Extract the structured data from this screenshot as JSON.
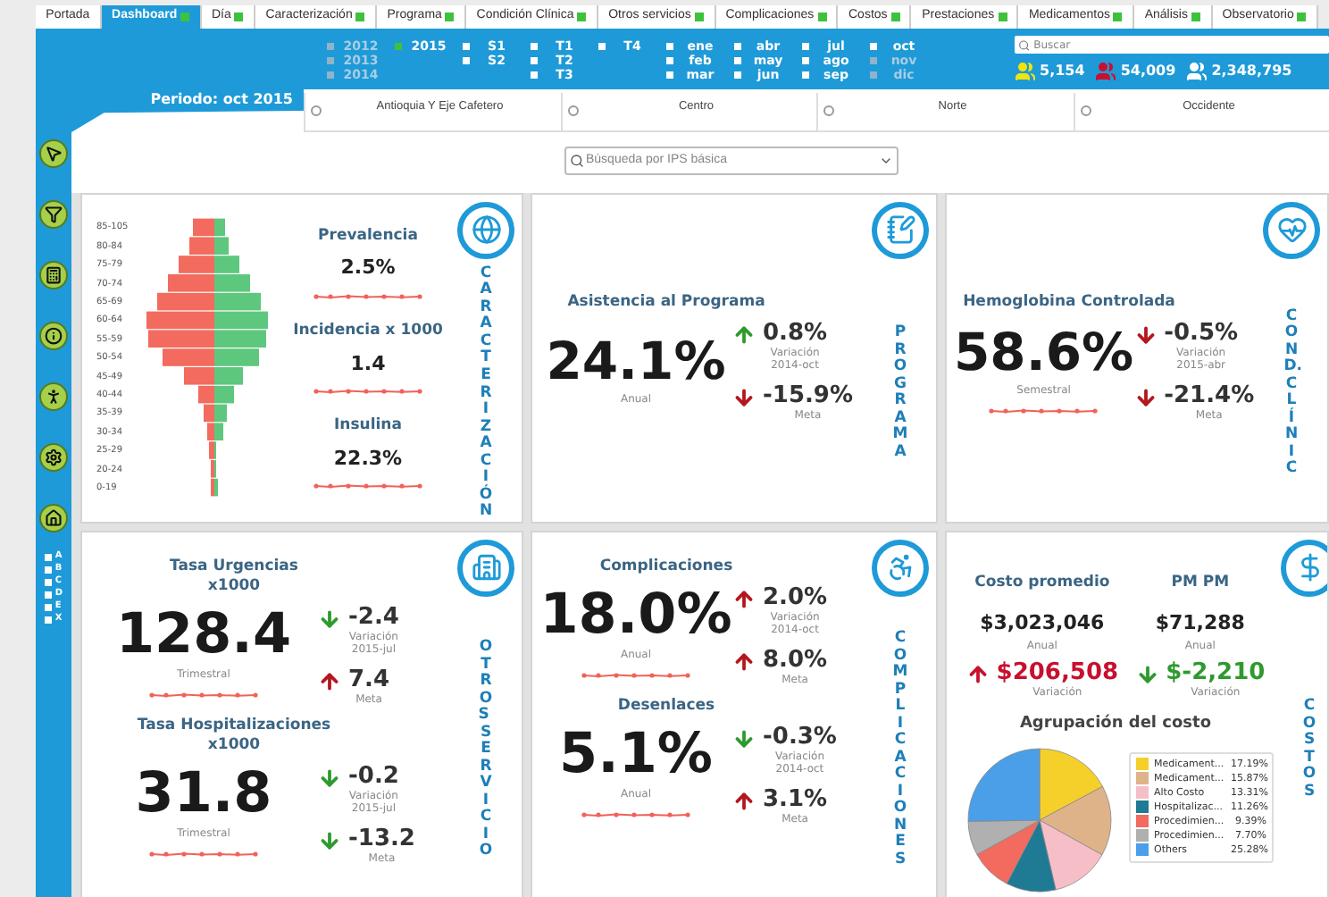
{
  "tabs": [
    {
      "label": "Portada",
      "selected": false,
      "status_dot": false
    },
    {
      "label": "Dashboard",
      "selected": true,
      "status_dot": true
    },
    {
      "label": "Día",
      "selected": false,
      "status_dot": true
    },
    {
      "label": "Caracterización",
      "selected": false,
      "status_dot": true
    },
    {
      "label": "Programa",
      "selected": false,
      "status_dot": true
    },
    {
      "label": "Condición Clínica",
      "selected": false,
      "status_dot": true
    },
    {
      "label": "Otros servicios",
      "selected": false,
      "status_dot": true
    },
    {
      "label": "Complicaciones",
      "selected": false,
      "status_dot": true
    },
    {
      "label": "Costos",
      "selected": false,
      "status_dot": true
    },
    {
      "label": "Prestaciones",
      "selected": false,
      "status_dot": true
    },
    {
      "label": "Medicamentos",
      "selected": false,
      "status_dot": true
    },
    {
      "label": "Análisis",
      "selected": false,
      "status_dot": true
    },
    {
      "label": "Observatorio",
      "selected": false,
      "status_dot": true
    }
  ],
  "period_selector": [
    {
      "items": [
        {
          "label": "2012",
          "selected": false,
          "disabled": true
        },
        {
          "label": "2013",
          "selected": false,
          "disabled": true
        },
        {
          "label": "2014",
          "selected": false,
          "disabled": true
        }
      ]
    },
    {
      "items": [
        {
          "label": "2015",
          "selected": true,
          "disabled": false
        }
      ]
    },
    {
      "items": [
        {
          "label": "S1",
          "selected": false,
          "disabled": false
        },
        {
          "label": "S2",
          "selected": false,
          "disabled": false
        }
      ]
    },
    {
      "items": [
        {
          "label": "T1",
          "selected": false,
          "disabled": false
        },
        {
          "label": "T2",
          "selected": false,
          "disabled": false
        },
        {
          "label": "T3",
          "selected": false,
          "disabled": false
        }
      ]
    },
    {
      "items": [
        {
          "label": "T4",
          "selected": false,
          "disabled": false
        }
      ]
    },
    {
      "items": [
        {
          "label": "ene",
          "selected": false,
          "disabled": false
        },
        {
          "label": "feb",
          "selected": false,
          "disabled": false
        },
        {
          "label": "mar",
          "selected": false,
          "disabled": false
        }
      ]
    },
    {
      "items": [
        {
          "label": "abr",
          "selected": false,
          "disabled": false
        },
        {
          "label": "may",
          "selected": false,
          "disabled": false
        },
        {
          "label": "jun",
          "selected": false,
          "disabled": false
        }
      ]
    },
    {
      "items": [
        {
          "label": "jul",
          "selected": false,
          "disabled": false
        },
        {
          "label": "ago",
          "selected": false,
          "disabled": false
        },
        {
          "label": "sep",
          "selected": false,
          "disabled": false
        }
      ]
    },
    {
      "items": [
        {
          "label": "oct",
          "selected": false,
          "disabled": false
        },
        {
          "label": "nov",
          "selected": false,
          "disabled": true
        },
        {
          "label": "dic",
          "selected": false,
          "disabled": true
        }
      ]
    }
  ],
  "search": {
    "placeholder": "Buscar"
  },
  "stats": [
    {
      "value": "5,154",
      "color": "#f2e40c"
    },
    {
      "value": "54,009",
      "color": "#c8102e"
    },
    {
      "value": "2,348,795",
      "color": "#ffffff"
    }
  ],
  "period_label": "Periodo: oct 2015",
  "regions": [
    {
      "label": "Antioquia Y Eje Cafetero",
      "selected": false
    },
    {
      "label": "Centro",
      "selected": false
    },
    {
      "label": "Norte",
      "selected": false
    },
    {
      "label": "Occidente",
      "selected": false
    }
  ],
  "ips_search": {
    "placeholder": "Búsqueda por IPS básica"
  },
  "sidebar": {
    "filters": [
      {
        "label": "A",
        "checked": false
      },
      {
        "label": "B",
        "checked": false
      },
      {
        "label": "C",
        "checked": false
      },
      {
        "label": "D",
        "checked": false
      },
      {
        "label": "E",
        "checked": false
      },
      {
        "label": "X",
        "checked": false
      }
    ]
  },
  "cards": [
    {
      "kind": "pyramid",
      "section": "CARACTERIZACIÓN",
      "age_groups": [
        "85-105",
        "80-84",
        "75-79",
        "70-74",
        "65-69",
        "60-64",
        "55-59",
        "50-54",
        "45-49",
        "40-44",
        "35-39",
        "30-34",
        "25-29",
        "20-24",
        "0-19"
      ],
      "metrics": [
        {
          "title": "Prevalencia",
          "value": "2.5%",
          "sparkline": true
        },
        {
          "title": "Incidencia x 1000",
          "value": "1.4",
          "sparkline": true
        },
        {
          "title": "Insulina",
          "value": "22.3%",
          "sparkline": true
        }
      ]
    },
    {
      "kind": "kpi",
      "section": "PROGRAMA",
      "blocks": [
        {
          "title": "Asistencia al Programa",
          "value": "24.1%",
          "period": "Anual",
          "sparkline": false,
          "changes": [
            {
              "rising": true,
              "color": "#2e9a2e",
              "value": "0.8%",
              "caption": "Variación\n2014-oct"
            },
            {
              "rising": false,
              "color": "#b3171d",
              "value": "-15.9%",
              "caption": "Meta"
            }
          ]
        }
      ]
    },
    {
      "kind": "kpi",
      "section": "COND. CLÍNIC",
      "blocks": [
        {
          "title": "Hemoglobina Controlada",
          "value": "58.6%",
          "period": "Semestral",
          "sparkline": true,
          "changes": [
            {
              "rising": false,
              "color": "#b3171d",
              "value": "-0.5%",
              "caption": "Variación\n2015-abr"
            },
            {
              "rising": false,
              "color": "#b3171d",
              "value": "-21.4%",
              "caption": "Meta"
            }
          ]
        }
      ]
    },
    {
      "kind": "kpi",
      "section": "OTROS SERVICIO",
      "blocks": [
        {
          "title": "Tasa Urgencias\nx1000",
          "value": "128.4",
          "period": "Trimestral",
          "sparkline": true,
          "changes": [
            {
              "rising": false,
              "color": "#2e9a2e",
              "value": "-2.4",
              "caption": "Variación\n2015-jul"
            },
            {
              "rising": true,
              "color": "#b3171d",
              "value": "7.4",
              "caption": "Meta"
            }
          ]
        },
        {
          "title": "Tasa Hospitalizaciones\nx1000",
          "value": "31.8",
          "period": "Trimestral",
          "sparkline": true,
          "changes": [
            {
              "rising": false,
              "color": "#2e9a2e",
              "value": "-0.2",
              "caption": "Variación\n2015-jul"
            },
            {
              "rising": false,
              "color": "#2e9a2e",
              "value": "-13.2",
              "caption": "Meta"
            }
          ]
        }
      ]
    },
    {
      "kind": "kpi",
      "section": "COMPLICACIONES",
      "blocks": [
        {
          "title": "Complicaciones",
          "value": "18.0%",
          "period": "Anual",
          "sparkline": true,
          "changes": [
            {
              "rising": true,
              "color": "#b3171d",
              "value": "2.0%",
              "caption": "Variación\n2014-oct"
            },
            {
              "rising": true,
              "color": "#b3171d",
              "value": "8.0%",
              "caption": "Meta"
            }
          ]
        },
        {
          "title": "Desenlaces",
          "value": "5.1%",
          "period": "Anual",
          "sparkline": true,
          "changes": [
            {
              "rising": false,
              "color": "#2e9a2e",
              "value": "-0.3%",
              "caption": "Variación\n2014-oct"
            },
            {
              "rising": true,
              "color": "#b3171d",
              "value": "3.1%",
              "caption": "Meta"
            }
          ]
        }
      ]
    },
    {
      "kind": "cost",
      "section": "COSTOS",
      "metrics": [
        {
          "title": "Costo promedio",
          "value": "$3,023,046",
          "period": "Anual",
          "change": {
            "rising": true,
            "color": "#c8102e",
            "value": "$206,508",
            "caption": "Variación"
          }
        },
        {
          "title": "PM PM",
          "value": "$71,288",
          "period": "Anual",
          "change": {
            "rising": false,
            "color": "#2e9a2e",
            "value": "$-2,210",
            "caption": "Variación"
          }
        }
      ],
      "chart_data": {
        "type": "pie",
        "title": "Agrupación del costo",
        "legend": "right",
        "categories": [
          "Medicament...",
          "Medicament...",
          "Alto Costo",
          "Hospitalizac...",
          "Procedimien...",
          "Procedimien...",
          "Others"
        ],
        "series": [
          {
            "values": [
              17.19,
              15.87,
              13.31,
              11.26,
              9.39,
              7.7,
              25.28
            ]
          }
        ],
        "colors": [
          "#f5d02a",
          "#dfb38a",
          "#f6bfc8",
          "#1f7a94",
          "#f26b5e",
          "#b0b0b0",
          "#4a9fe8"
        ],
        "value_labels": [
          "17.19%",
          "15.87%",
          "13.31%",
          "11.26%",
          "9.39%",
          "7.70%",
          "25.28%"
        ]
      }
    }
  ]
}
